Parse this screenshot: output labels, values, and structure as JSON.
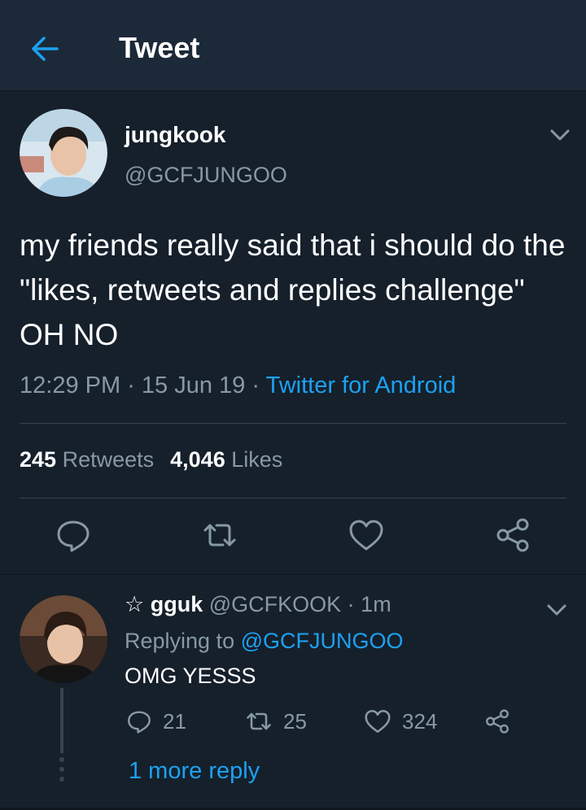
{
  "header": {
    "title": "Tweet",
    "back_icon": "arrow-left-icon"
  },
  "tweet": {
    "author_name": "jungkook",
    "author_handle": "@GCFJUNGOO",
    "text": "my friends really said that i should do the \"likes, retweets and replies challenge\" OH NO",
    "time": "12:29 PM",
    "date": "15 Jun 19",
    "source": "Twitter for Android",
    "retweets_count": "245",
    "retweets_label": "Retweets",
    "likes_count": "4,046",
    "likes_label": "Likes",
    "actions": [
      "reply-icon",
      "retweet-icon",
      "like-icon",
      "share-icon"
    ]
  },
  "reply": {
    "star": "☆",
    "name": "gguk",
    "handle": "@GCFKOOK",
    "age": "1m",
    "replying_prefix": "Replying to",
    "replying_to": "@GCFJUNGOO",
    "text": "OMG YESSS",
    "reply_count": "21",
    "retweet_count": "25",
    "like_count": "324",
    "more_replies": "1 more reply"
  },
  "colors": {
    "background": "#15202b",
    "header_bg": "#1c2938",
    "accent": "#1da1f2",
    "muted": "#8899a6",
    "divider": "#38444d"
  }
}
